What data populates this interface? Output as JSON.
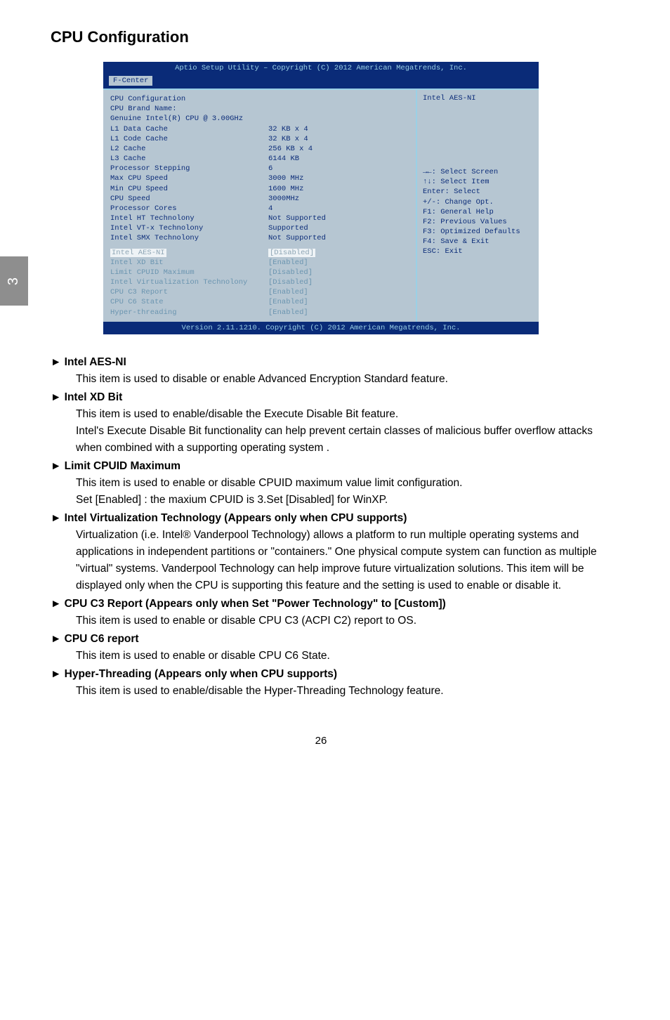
{
  "side_tab": "3",
  "heading": "CPU Configuration",
  "bios": {
    "title": "Aptio Setup Utility – Copyright (C) 2012 American Megatrends, Inc.",
    "tab": "F-Center",
    "footer": "Version 2.11.1210. Copyright (C) 2012 American Megatrends, Inc.",
    "section_title": "CPU Configuration",
    "brand_label": "CPU Brand Name:",
    "brand_value": "Genuine Intel(R) CPU @ 3.00GHz",
    "rows_basic": [
      {
        "k": "L1 Data Cache",
        "v": "32 KB x 4"
      },
      {
        "k": "L1 Code Cache",
        "v": "32 KB x 4"
      },
      {
        "k": "L2 Cache",
        "v": "256 KB x 4"
      },
      {
        "k": "L3 Cache",
        "v": "6144 KB"
      },
      {
        "k": "Processor Stepping",
        "v": "6"
      },
      {
        "k": "Max CPU Speed",
        "v": "3000 MHz"
      },
      {
        "k": "Min CPU Speed",
        "v": "1600 MHz"
      },
      {
        "k": "CPU Speed",
        "v": "3000MHz"
      },
      {
        "k": "Processor Cores",
        "v": "4"
      },
      {
        "k": "Intel HT Technolony",
        "v": "Not Supported"
      },
      {
        "k": "Intel VT-x Technolony",
        "v": "Supported"
      },
      {
        "k": "Intel SMX Technolony",
        "v": "Not Supported"
      }
    ],
    "row_selected": {
      "k": "Intel AES-NI",
      "v": "[Disabled]"
    },
    "rows_options": [
      {
        "k": "Intel XD Bit",
        "v": "[Enabled]"
      },
      {
        "k": "Limit CPUID Maximum",
        "v": "[Disabled]"
      },
      {
        "k": "Intel Virtualization Technolony",
        "v": "[Disabled]"
      },
      {
        "k": "CPU C3 Report",
        "v": "[Enabled]"
      },
      {
        "k": "CPU C6 State",
        "v": "[Enabled]"
      },
      {
        "k": "Hyper-threading",
        "v": "[Enabled]"
      }
    ],
    "help_title": "Intel AES-NI",
    "help_lines": [
      "→←: Select Screen",
      "↑↓: Select Item",
      "Enter: Select",
      "+/-: Change Opt.",
      "F1: General Help",
      "F2: Previous Values",
      "F3: Optimized Defaults",
      "F4: Save & Exit",
      "ESC: Exit"
    ]
  },
  "desc": {
    "items": [
      {
        "head": "► Intel AES-NI",
        "body": [
          "This item is used to disable or enable Advanced Encryption Standard feature."
        ]
      },
      {
        "head": "► Intel XD Bit",
        "body": [
          "This item is used to enable/disable the Execute Disable Bit feature.",
          "Intel's Execute Disable Bit functionality can help prevent certain classes of malicious buffer overflow attacks when combined with a supporting operating system ."
        ]
      },
      {
        "head": "► Limit CPUID Maximum",
        "body": [
          "This item is used to enable or disable CPUID maximum value limit configuration.",
          " Set [Enabled] : the maxium CPUID is 3.Set [Disabled] for WinXP."
        ]
      },
      {
        "head": "► Intel Virtualization Technology  (Appears only when CPU supports)",
        "body": [
          "Virtualization (i.e. Intel® Vanderpool Technology) allows a platform to run multiple operating systems and applications in independent partitions or \"containers.\" One physical compute system can function as multiple \"virtual\" systems. Vanderpool Technology can help improve future virtualization solutions. This item will be displayed only when the CPU is supporting this feature and the setting is used to enable or disable it."
        ]
      },
      {
        "head": "► CPU C3 Report (Appears only when Set \"Power Technology\" to [Custom])",
        "body": [
          "This item is used to enable or disable CPU C3 (ACPI C2) report to OS."
        ]
      },
      {
        "head": "► CPU C6 report",
        "body": [
          "This item is used to enable or disable CPU C6 State."
        ]
      },
      {
        "head": "► Hyper-Threading (Appears only when CPU supports)",
        "body": [
          "This item is used to enable/disable the Hyper-Threading Technology feature."
        ]
      }
    ]
  },
  "page_number": "26"
}
